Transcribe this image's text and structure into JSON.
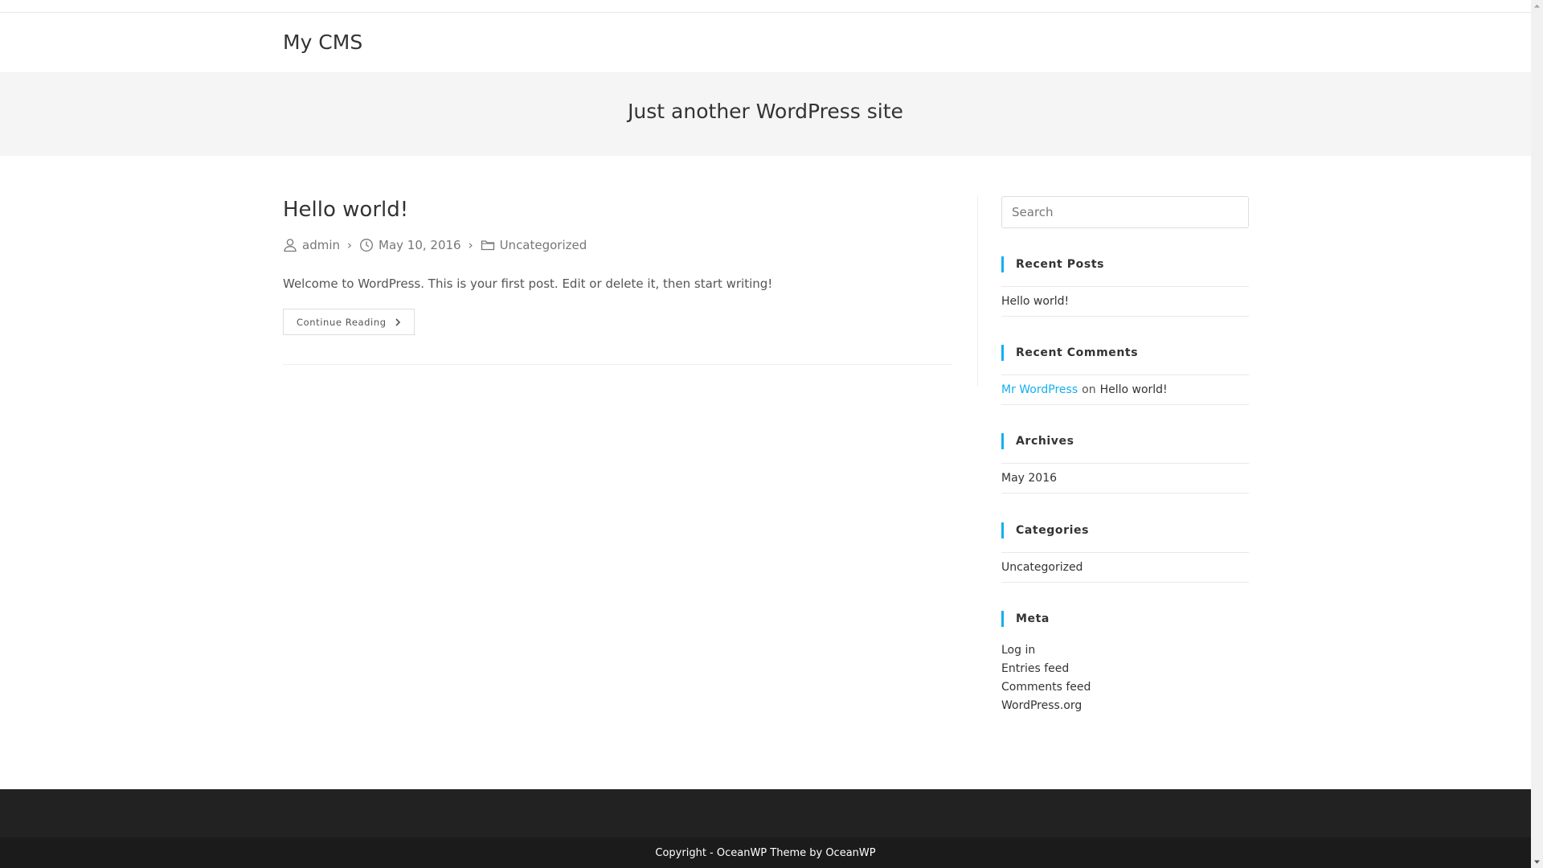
{
  "site": {
    "title": "My CMS",
    "tagline": "Just another WordPress site"
  },
  "post": {
    "title": "Hello world!",
    "author": "admin",
    "date": "May 10, 2016",
    "category": "Uncategorized",
    "excerpt": "Welcome to WordPress. This is your first post. Edit or delete it, then start writing!",
    "continue_label": "Continue Reading",
    "icons": {
      "author": "user-icon",
      "date": "clock-icon",
      "category": "folder-icon",
      "continue": "chevron-right-icon"
    }
  },
  "sidebar": {
    "search_placeholder": "Search",
    "recent_posts": {
      "title": "Recent Posts",
      "items": [
        "Hello world!"
      ]
    },
    "recent_comments": {
      "title": "Recent Comments",
      "author": "Mr WordPress",
      "connector": "on",
      "post": "Hello world!"
    },
    "archives": {
      "title": "Archives",
      "items": [
        "May 2016"
      ]
    },
    "categories": {
      "title": "Categories",
      "items": [
        "Uncategorized"
      ]
    },
    "meta": {
      "title": "Meta",
      "items": [
        "Log in",
        "Entries feed",
        "Comments feed",
        "WordPress.org"
      ]
    }
  },
  "footer": {
    "copyright": "Copyright - OceanWP Theme by OceanWP"
  },
  "colors": {
    "accent": "#13aff0",
    "footer_bg": "#222222",
    "footer_bottom_bg": "#1b1b1b",
    "page_header_bg": "#f5f5f5"
  }
}
